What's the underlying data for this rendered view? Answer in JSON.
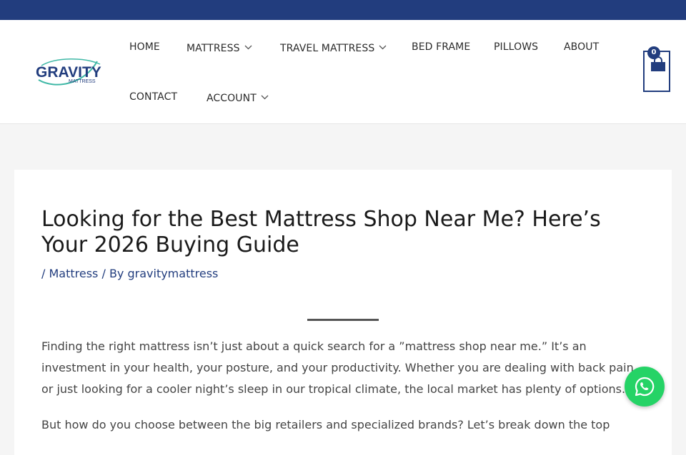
{
  "colors": {
    "brand": "#223d7e",
    "whatsapp": "#25d366",
    "logo_teal": "#3fb8a6"
  },
  "logo": {
    "text": "GRAVITY",
    "subtext": "MATTRESS"
  },
  "nav": {
    "home": "HOME",
    "mattress": "MATTRESS",
    "travel_mattress": "TRAVEL MATTRESS",
    "bed_frame": "BED FRAME",
    "pillows": "PILLOWS",
    "about": "ABOUT",
    "contact": "CONTACT",
    "account": "ACCOUNT"
  },
  "cart": {
    "count": "0",
    "icon": "shopping-bag-icon"
  },
  "article": {
    "title": "Looking for the Best Mattress Shop Near Me? Here’s Your 2026 Buying Guide",
    "meta_prefix": "/ ",
    "category": "Mattress",
    "meta_by": " / By ",
    "author": "gravitymattress",
    "paragraph1": "Finding the right mattress isn’t just about a quick search for a ”mattress shop near me.” It’s an investment in your health, your posture, and your productivity. Whether you are dealing with back pain or just looking for a cooler night’s sleep in our tropical climate, the local market has plenty of options.",
    "paragraph2": "But how do you choose between the big retailers and specialized brands? Let’s break down the top"
  },
  "whatsapp": {
    "icon": "whatsapp-icon"
  }
}
